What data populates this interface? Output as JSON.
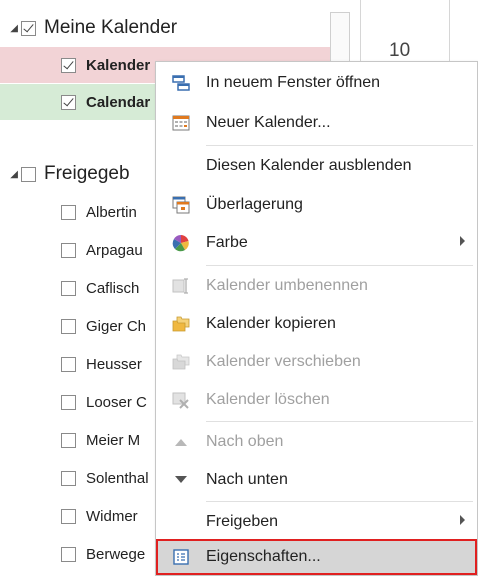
{
  "navigation": {
    "my_calendars": {
      "label": "Meine Kalender",
      "checked": true,
      "items": [
        {
          "label": "Kalender",
          "checked": true,
          "bold": true,
          "color": "#f2d3d6"
        },
        {
          "label": "Calendar",
          "checked": true,
          "bold": true,
          "color": "#d6ebd6"
        }
      ]
    },
    "shared_calendars": {
      "label": "Freigegeb",
      "checked": false,
      "items": [
        {
          "label": "Albertin"
        },
        {
          "label": "Arpagau"
        },
        {
          "label": "Caflisch"
        },
        {
          "label": "Giger Ch"
        },
        {
          "label": "Heusser"
        },
        {
          "label": "Looser C"
        },
        {
          "label": "Meier M"
        },
        {
          "label": "Solenthal"
        },
        {
          "label": "Widmer"
        },
        {
          "label": "Berwege"
        }
      ]
    }
  },
  "calendar": {
    "day_number": "10"
  },
  "context_menu": {
    "items": [
      {
        "label": "In neuem Fenster öffnen",
        "icon": "new-window-icon",
        "disabled": false
      },
      {
        "label": "Neuer Kalender...",
        "icon": "new-calendar-icon",
        "disabled": false
      },
      {
        "label": "Diesen Kalender ausblenden",
        "icon": "",
        "disabled": false
      },
      {
        "label": "Überlagerung",
        "icon": "overlay-icon",
        "disabled": false
      },
      {
        "label": "Farbe",
        "icon": "color-palette-icon",
        "disabled": false,
        "submenu": true
      },
      {
        "label": "Kalender umbenennen",
        "icon": "rename-icon",
        "disabled": true
      },
      {
        "label": "Kalender kopieren",
        "icon": "copy-folder-icon",
        "disabled": false
      },
      {
        "label": "Kalender verschieben",
        "icon": "move-folder-icon",
        "disabled": true
      },
      {
        "label": "Kalender löschen",
        "icon": "delete-calendar-icon",
        "disabled": true
      },
      {
        "label": "Nach oben",
        "icon": "arrow-up-icon",
        "disabled": true
      },
      {
        "label": "Nach unten",
        "icon": "arrow-down-icon",
        "disabled": false
      },
      {
        "label": "Freigeben",
        "icon": "",
        "disabled": false,
        "submenu": true
      },
      {
        "label": "Eigenschaften...",
        "icon": "properties-icon",
        "disabled": false,
        "highlighted": true
      }
    ]
  },
  "colors": {
    "highlight_outline": "#e02020",
    "highlight_fill": "#d6d6d6",
    "calendar_icon_orange": "#e07a1f",
    "folder_yellow": "#f0b840"
  }
}
